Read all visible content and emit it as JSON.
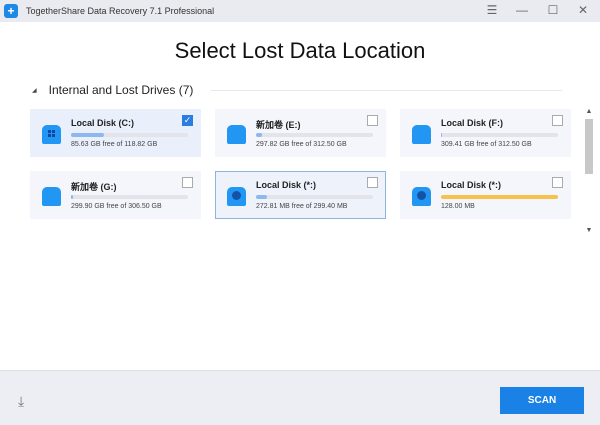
{
  "window": {
    "title": "TogetherShare Data Recovery 7.1 Professional",
    "menu_icon": "☰",
    "minimize_icon": "—",
    "maximize_icon": "☐",
    "close_icon": "✕"
  },
  "heading": "Select Lost Data Location",
  "section": {
    "title": "Internal and Lost Drives (7)"
  },
  "drives": [
    {
      "name": "Local Disk (C:)",
      "size": "85.63 GB free of 118.82 GB",
      "used_percent": 28,
      "checked": true,
      "icon": "windows-disk-icon",
      "bar_color": "#8cb8ef"
    },
    {
      "name": "新加卷 (E:)",
      "size": "297.82 GB free of 312.50 GB",
      "used_percent": 5,
      "checked": false,
      "icon": "disk-icon",
      "bar_color": "#8cb8ef"
    },
    {
      "name": "Local Disk (F:)",
      "size": "309.41 GB free of 312.50 GB",
      "used_percent": 1,
      "checked": false,
      "icon": "disk-icon",
      "bar_color": "#8cb8ef"
    },
    {
      "name": "新加卷 (G:)",
      "size": "299.90 GB free of 306.50 GB",
      "used_percent": 2,
      "checked": false,
      "icon": "disk-icon",
      "bar_color": "#8cb8ef"
    },
    {
      "name": "Local Disk (*:)",
      "size": "272.81 MB free of 299.40 MB",
      "used_percent": 9,
      "checked": false,
      "icon": "lost-disk-icon",
      "bar_color": "#8cb8ef"
    },
    {
      "name": "Local Disk (*:)",
      "size": "128.00 MB",
      "used_percent": 100,
      "checked": false,
      "icon": "lost-disk-icon",
      "bar_color": "#f7c14c"
    }
  ],
  "footer": {
    "scan_label": "SCAN"
  }
}
